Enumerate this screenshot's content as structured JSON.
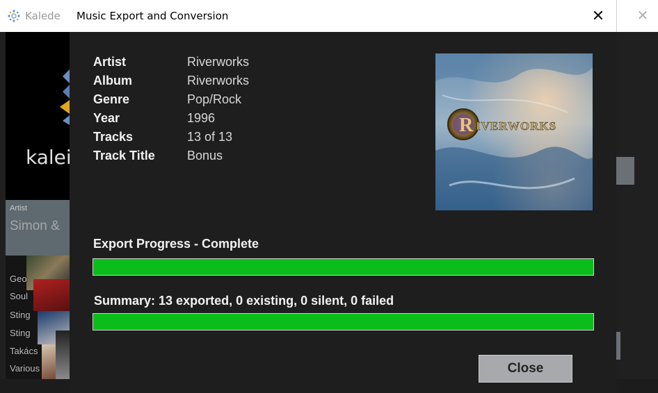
{
  "background_app": {
    "title": "Kalede",
    "logo_text": "kalei",
    "artist_label": "Artist",
    "artist_value": "Simon &",
    "list_items": [
      "Geo",
      "Soul",
      "Sting",
      "Sting",
      "Takács",
      "Various"
    ]
  },
  "dialog": {
    "title": "Music Export and Conversion",
    "close_glyph": "✕",
    "info": [
      {
        "label": "Artist",
        "value": "Riverworks"
      },
      {
        "label": "Album",
        "value": "Riverworks"
      },
      {
        "label": "Genre",
        "value": "Pop/Rock"
      },
      {
        "label": "Year",
        "value": "1996"
      },
      {
        "label": "Tracks",
        "value": "13 of 13"
      },
      {
        "label": "Track Title",
        "value": "Bonus"
      }
    ],
    "album_art_text": "RIVERWORKS",
    "progress": {
      "label": "Export Progress - Complete",
      "fraction": 1.0
    },
    "summary": {
      "label": "Summary:  13 exported, 0 existing, 0 silent, 0 failed",
      "fraction": 1.0
    },
    "close_button_label": "Close"
  },
  "colors": {
    "progress_fill": "#0bbd1b",
    "dialog_background": "#1e1e1e",
    "button_background": "#a7a9ad"
  }
}
